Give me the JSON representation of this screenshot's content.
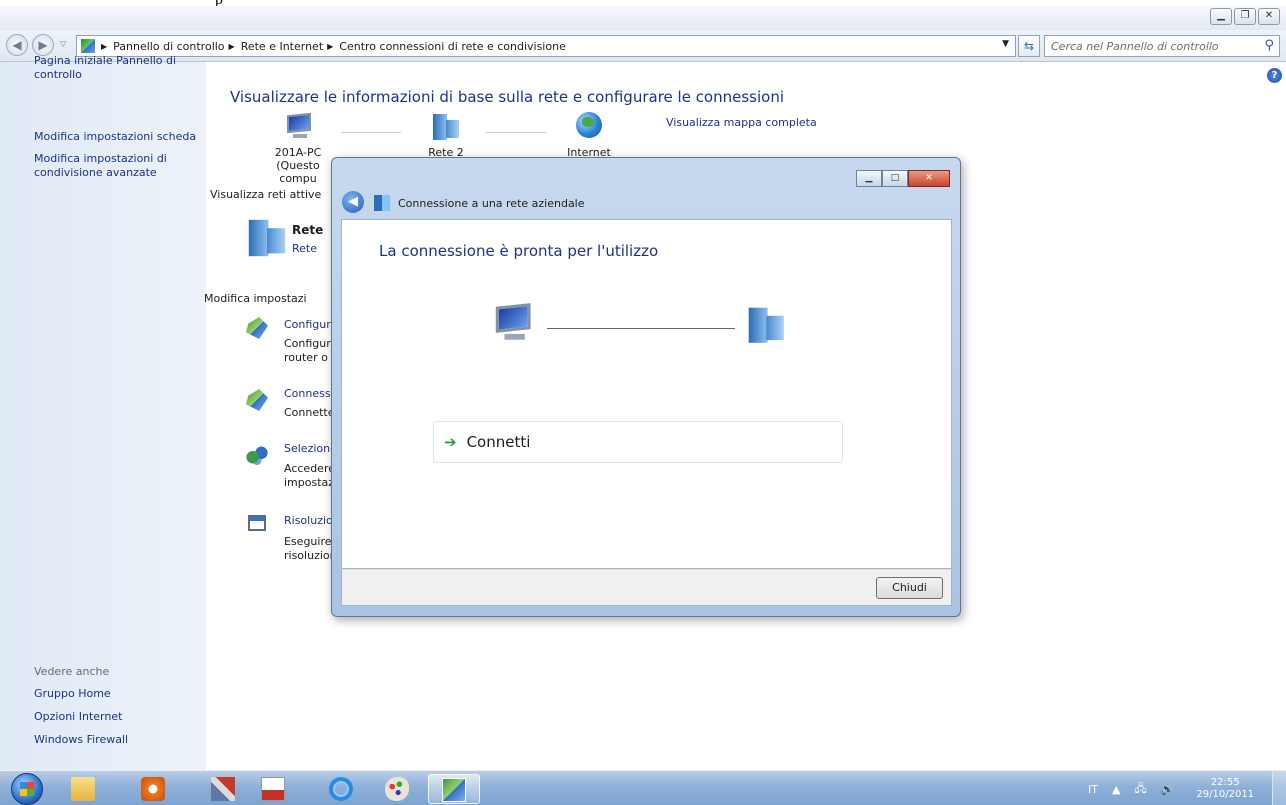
{
  "top_fragment": "p",
  "window": {
    "caption_buttons": [
      "minimize",
      "maximize",
      "close"
    ]
  },
  "address": {
    "breadcrumbs": [
      "Pannello di controllo",
      "Rete e Internet",
      "Centro connessioni di rete e condivisione"
    ],
    "search_placeholder": "Cerca nel Pannello di controllo"
  },
  "sidebar": {
    "links": [
      "Pagina iniziale Pannello di controllo",
      "Modifica impostazioni scheda",
      "Modifica impostazioni di condivisione avanzate"
    ],
    "see_also_header": "Vedere anche",
    "see_also": [
      "Gruppo Home",
      "Opzioni Internet",
      "Windows Firewall"
    ]
  },
  "main": {
    "title": "Visualizzare le informazioni di base sulla rete e configurare le connessioni",
    "map_link": "Visualizza mappa completa",
    "nodes": [
      {
        "label": "201A-PC",
        "sub": "(Questo compu"
      },
      {
        "label": "Rete  2",
        "sub": ""
      },
      {
        "label": "Internet",
        "sub": ""
      }
    ],
    "active_networks_label": "Visualizza reti attive",
    "network_name": "Rete",
    "network_type": "Rete",
    "change_settings_label": "Modifica impostazi",
    "tasks": [
      {
        "title": "Configura",
        "desc1": "Configura",
        "desc2": "router o u"
      },
      {
        "title": "Connessi",
        "desc1": "Connette",
        "desc2": ""
      },
      {
        "title": "Selezione",
        "desc1": "Accedere",
        "desc2": "impostaz"
      },
      {
        "title": "Risoluzio",
        "desc1": "Eseguire",
        "desc2": "risoluzion"
      }
    ]
  },
  "dialog": {
    "title": "Connessione a una rete aziendale",
    "heading": "La connessione è pronta per l'utilizzo",
    "connect_label": "Connetti",
    "close_label": "Chiudi"
  },
  "taskbar": {
    "apps": [
      "explorer-icon",
      "media-player-icon",
      "tools-icon",
      "pdf-icon",
      "internet-explorer-icon",
      "paint-icon",
      "control-panel-icon"
    ],
    "language": "IT",
    "time": "22:55",
    "date": "29/10/2011"
  }
}
